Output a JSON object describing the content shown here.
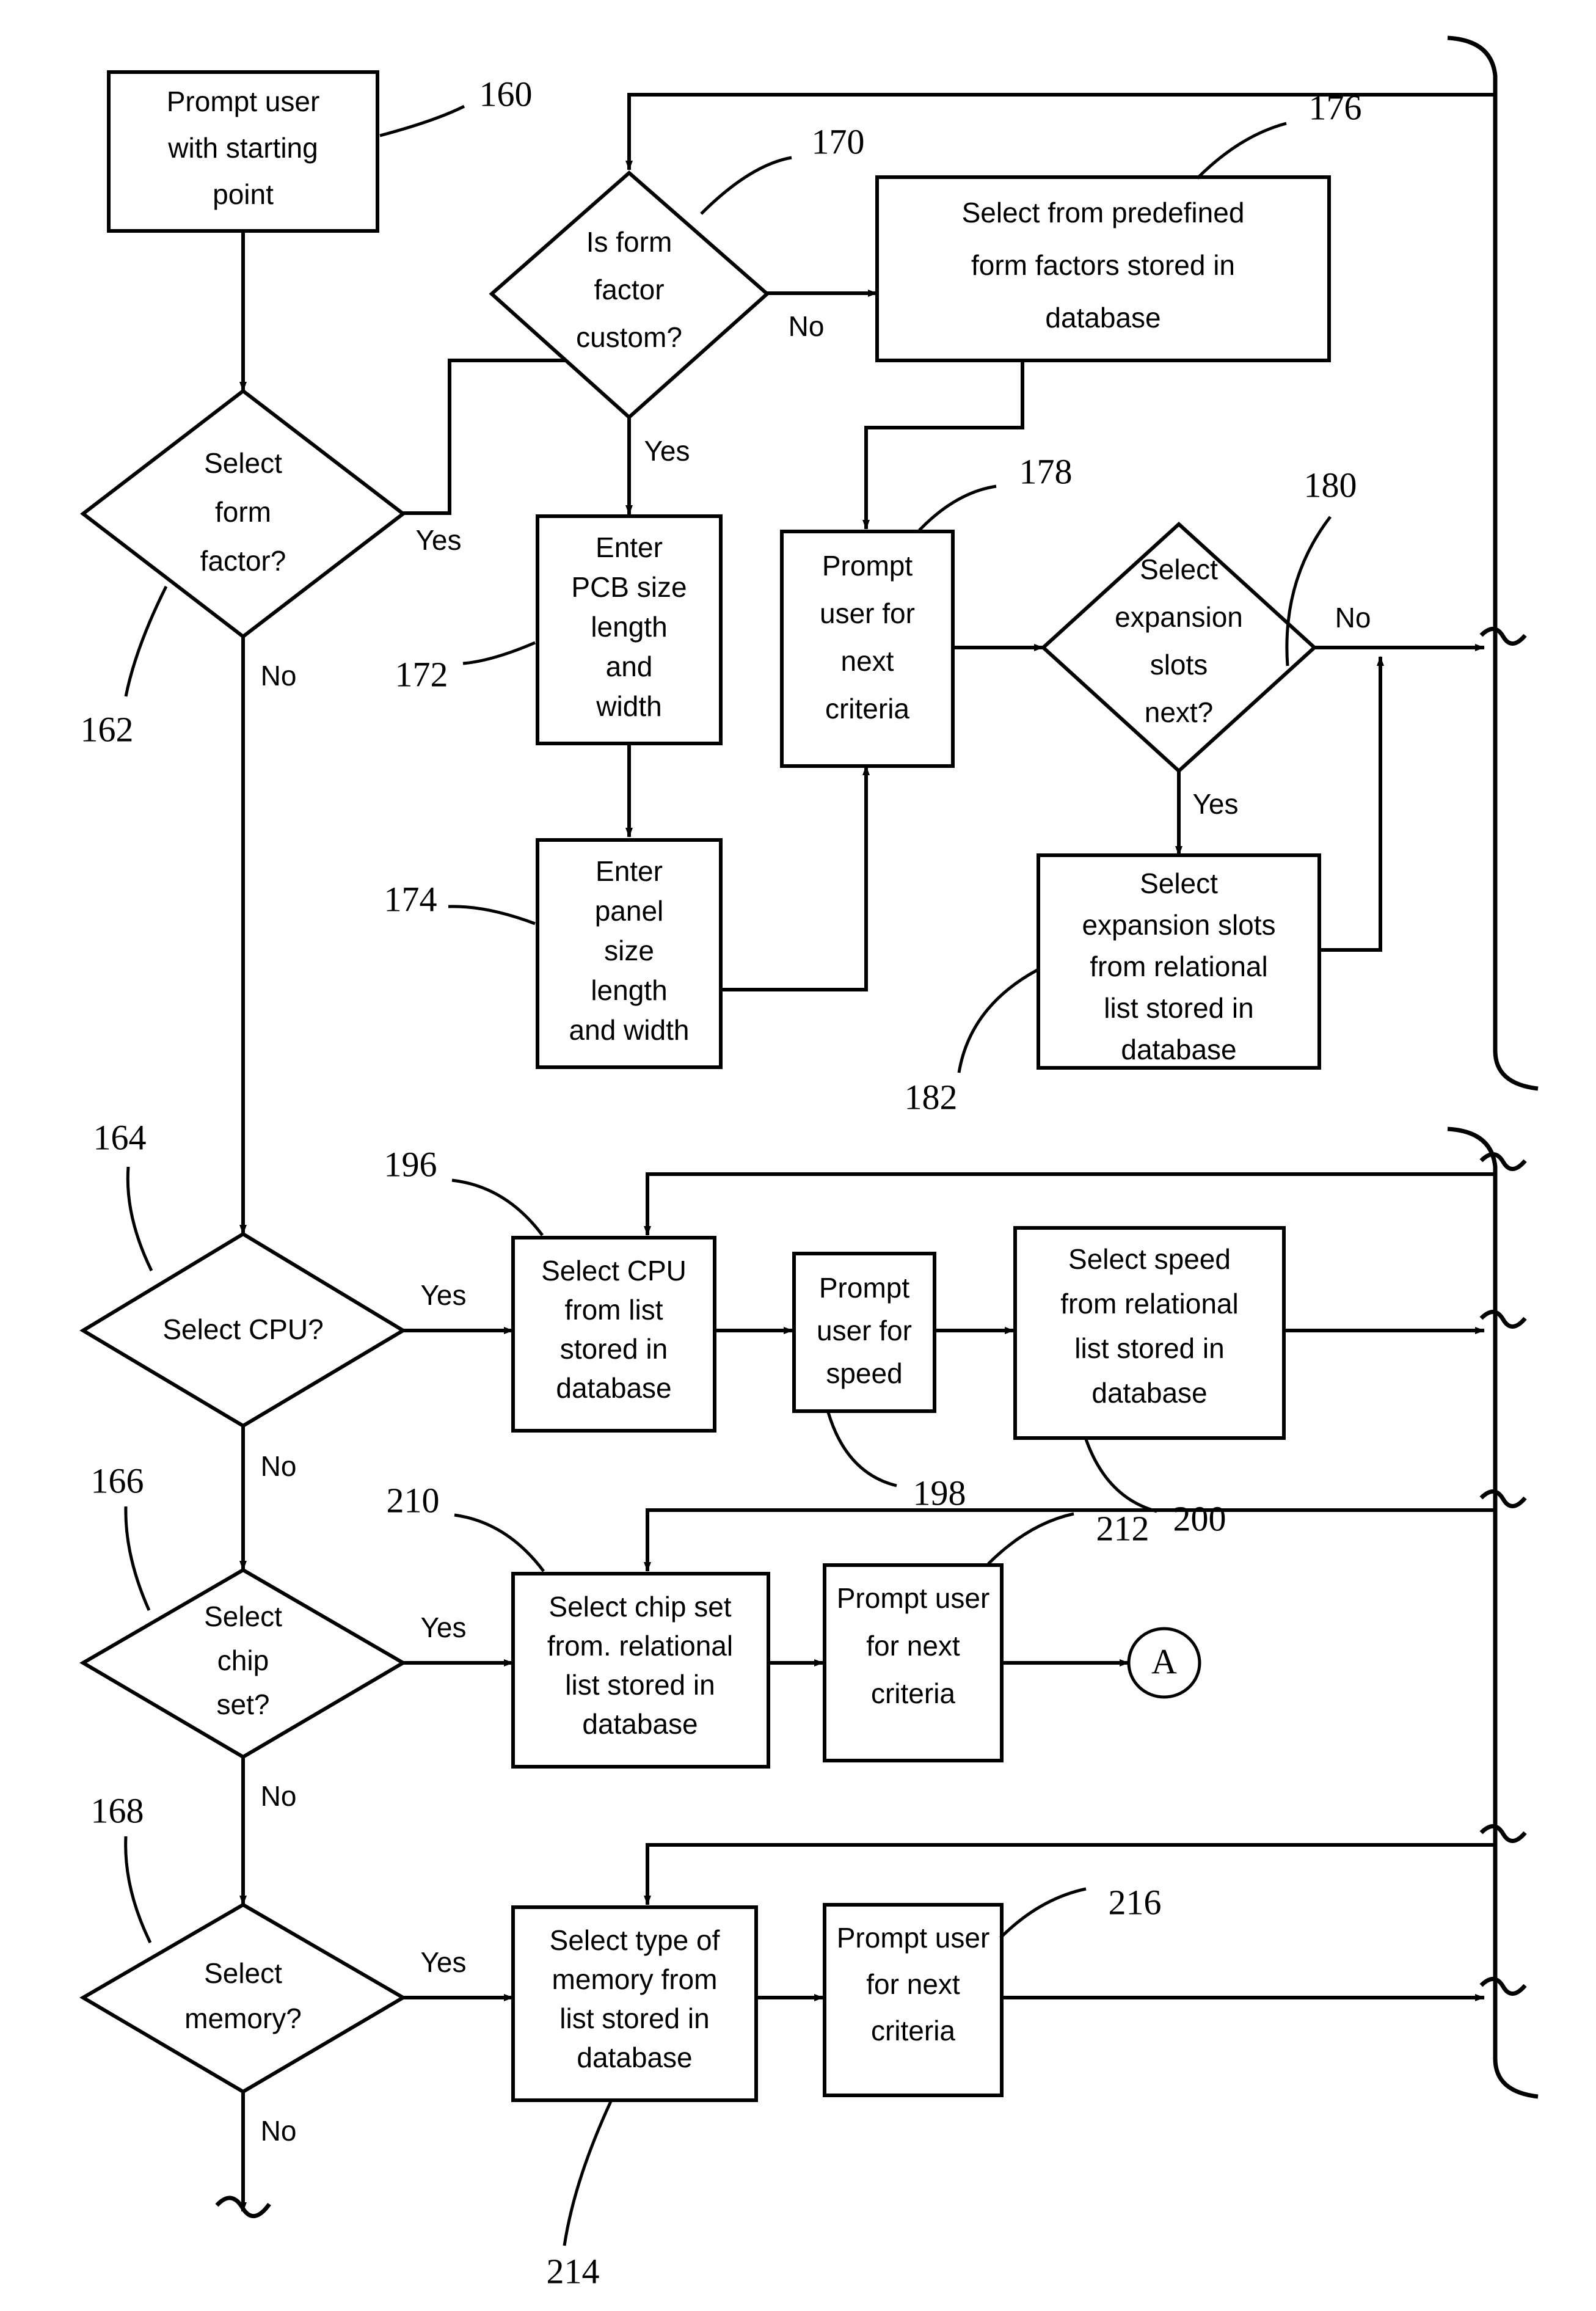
{
  "figure": {
    "type": "patent-flowchart",
    "title": "Motherboard configuration selection flowchart",
    "background_color": "#ffffff",
    "line_color": "#000000"
  },
  "nodes": {
    "n160": {
      "ref": "160",
      "shape": "process",
      "text": [
        "Prompt user",
        "with starting",
        "point"
      ]
    },
    "n162": {
      "ref": "162",
      "shape": "decision",
      "text": [
        "Select",
        "form",
        "factor?"
      ]
    },
    "n170": {
      "ref": "170",
      "shape": "decision",
      "text": [
        "Is form",
        "factor",
        "custom?"
      ]
    },
    "n176": {
      "ref": "176",
      "shape": "process",
      "text": [
        "Select from predefined",
        "form factors stored in",
        "database"
      ]
    },
    "n172": {
      "ref": "172",
      "shape": "process",
      "text": [
        "Enter",
        "PCB size",
        "length",
        "and",
        "width"
      ]
    },
    "n174": {
      "ref": "174",
      "shape": "process",
      "text": [
        "Enter",
        "panel",
        "size",
        "length",
        "and width"
      ]
    },
    "n178": {
      "ref": "178",
      "shape": "process",
      "text": [
        "Prompt",
        "user for",
        "next",
        "criteria"
      ]
    },
    "n180": {
      "ref": "180",
      "shape": "decision",
      "text": [
        "Select",
        "expansion",
        "slots",
        "next?"
      ]
    },
    "n182": {
      "ref": "182",
      "shape": "process",
      "text": [
        "Select",
        "expansion slots",
        "from relational",
        "list stored in",
        "database"
      ]
    },
    "n164": {
      "ref": "164",
      "shape": "decision",
      "text": [
        "Select CPU?"
      ]
    },
    "n196": {
      "ref": "196",
      "shape": "process",
      "text": [
        "Select CPU",
        "from list",
        "stored in",
        "database"
      ]
    },
    "n198": {
      "ref": "198",
      "shape": "process",
      "text": [
        "Prompt",
        "user for",
        "speed"
      ]
    },
    "n200": {
      "ref": "200",
      "shape": "process",
      "text": [
        "Select speed",
        "from relational",
        "list stored in",
        "database"
      ]
    },
    "n166": {
      "ref": "166",
      "shape": "decision",
      "text": [
        "Select",
        "chip",
        "set?"
      ]
    },
    "n210": {
      "ref": "210",
      "shape": "process",
      "text": [
        "Select chip set",
        "from. relational",
        "list stored in",
        "database"
      ]
    },
    "n212": {
      "ref": "212",
      "shape": "process",
      "text": [
        "Prompt user",
        "for next",
        "criteria"
      ]
    },
    "n168": {
      "ref": "168",
      "shape": "decision",
      "text": [
        "Select",
        "memory?"
      ]
    },
    "n214": {
      "ref": "214",
      "shape": "process",
      "text": [
        "Select type of",
        "memory from",
        "list stored in",
        "database"
      ]
    },
    "n216": {
      "ref": "216",
      "shape": "process",
      "text": [
        "Prompt user",
        "for next",
        "criteria"
      ]
    },
    "connA": {
      "shape": "connector-circle",
      "text": "A"
    }
  },
  "edge_labels": {
    "form_factor_yes": "Yes",
    "form_factor_no": "No",
    "custom_yes": "Yes",
    "custom_no": "No",
    "expansion_yes": "Yes",
    "expansion_no": "No",
    "cpu_yes": "Yes",
    "cpu_no": "No",
    "chipset_yes": "Yes",
    "chipset_no": "No",
    "memory_yes": "Yes",
    "memory_no": "No"
  },
  "reference_numerals": [
    "160",
    "162",
    "164",
    "166",
    "168",
    "170",
    "172",
    "174",
    "176",
    "178",
    "180",
    "182",
    "196",
    "198",
    "200",
    "210",
    "212",
    "214",
    "216"
  ]
}
